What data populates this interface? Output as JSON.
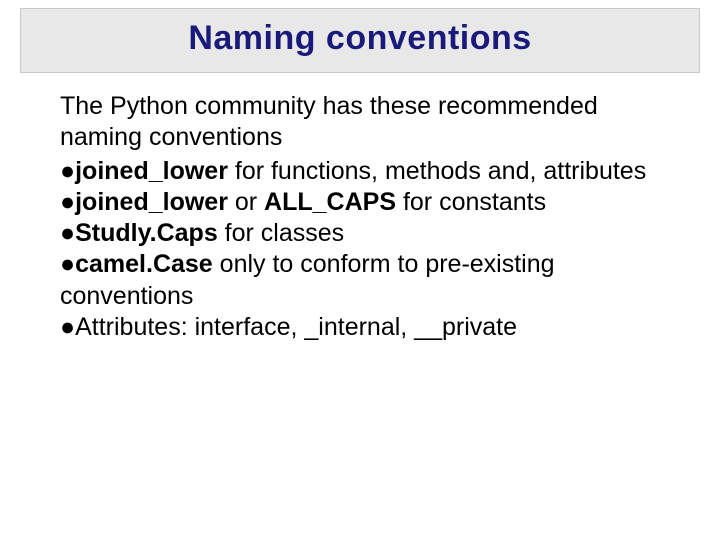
{
  "title": "Naming conventions",
  "intro": "The Python community has these recommend­ed naming conventions",
  "items": [
    {
      "bold1": "joined_lower",
      "rest": " for functions, methods and, attributes"
    },
    {
      "bold1": "joined_lower",
      "mid": " or ",
      "bold2": "ALL_CAPS",
      "rest": " for constants"
    },
    {
      "bold1": "Studly.Caps",
      "rest": " for classes"
    },
    {
      "bold1": "camel.Case",
      "rest": " only to conform to pre-existing conventions"
    },
    {
      "bold1": "",
      "rest": "Attributes: interface, _internal, __private"
    }
  ],
  "bullet": "●"
}
